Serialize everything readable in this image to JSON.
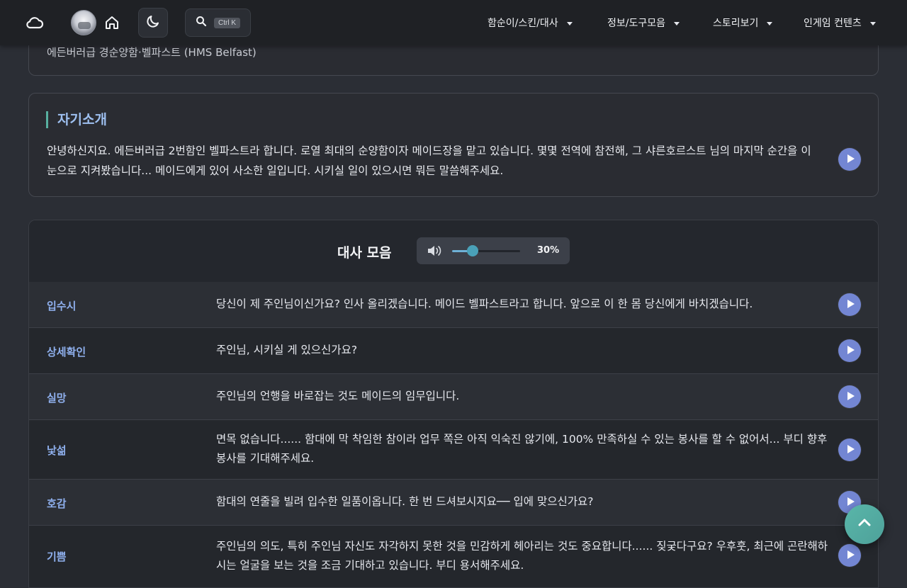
{
  "navbar": {
    "icons": [
      "cloud-icon",
      "avatar",
      "home-icon",
      "moon-icon",
      "search-icon"
    ],
    "search_shortcut": "Ctrl K",
    "menus": [
      "함순이/스킨/대사",
      "정보/도구모음",
      "스토리보기",
      "인게임 컨텐츠"
    ]
  },
  "top_card": {
    "subtitle": "에든버러급 경순양함·벨파스트 (HMS Belfast)"
  },
  "intro": {
    "title": "자기소개",
    "text": "안녕하신지요. 에든버러급 2번함인 벨파스트라 합니다. 로열 최대의 순양함이자 메이드장을 맡고 있습니다. 몇몇 전역에 참전해, 그 샤른호르스트 님의 마지막 순간을 이 눈으로 지켜봤습니다... 메이드에게 있어 사소한 일입니다. 시키실 일이 있으시면 뭐든 말씀해주세요."
  },
  "lines": {
    "title": "대사 모음",
    "volume_label": "30%",
    "volume_value": 0.3,
    "rows": [
      {
        "label": "입수시",
        "text": "당신이 제 주인님이신가요? 인사 올리겠습니다. 메이드 벨파스트라고 합니다. 앞으로 이 한 몸 당신에게 바치겠습니다."
      },
      {
        "label": "상세확인",
        "text": "주인님, 시키실 게 있으신가요?"
      },
      {
        "label": "실망",
        "text": "주인님의 언행을 바로잡는 것도 메이드의 임무입니다."
      },
      {
        "label": "낯섦",
        "text": "면목 없습니다...... 함대에 막 착임한 참이라 업무 쪽은 아직 익숙진 않기에, 100% 만족하실 수 있는 봉사를 할 수 없어서... 부디 향후 봉사를 기대해주세요."
      },
      {
        "label": "호감",
        "text": "함대의 연줄을 빌려 입수한 일품이옵니다. 한 번 드셔보시지요── 입에 맞으신가요?"
      },
      {
        "label": "기쁨",
        "text": "주인님의 의도, 특히 주인님 자신도 자각하지 못한 것을 민감하게 헤아리는 것도 중요합니다...... 짖궂다구요? 우후훗, 최근에 곤란해하시는 얼굴을 보는 것을 조금 기대하고 있습니다. 부디 용서해주세요."
      }
    ]
  },
  "colors": {
    "accent": "#7386d3",
    "label": "#8fb0ee",
    "teal": "#58b0a0",
    "background": "#2b2e35"
  }
}
